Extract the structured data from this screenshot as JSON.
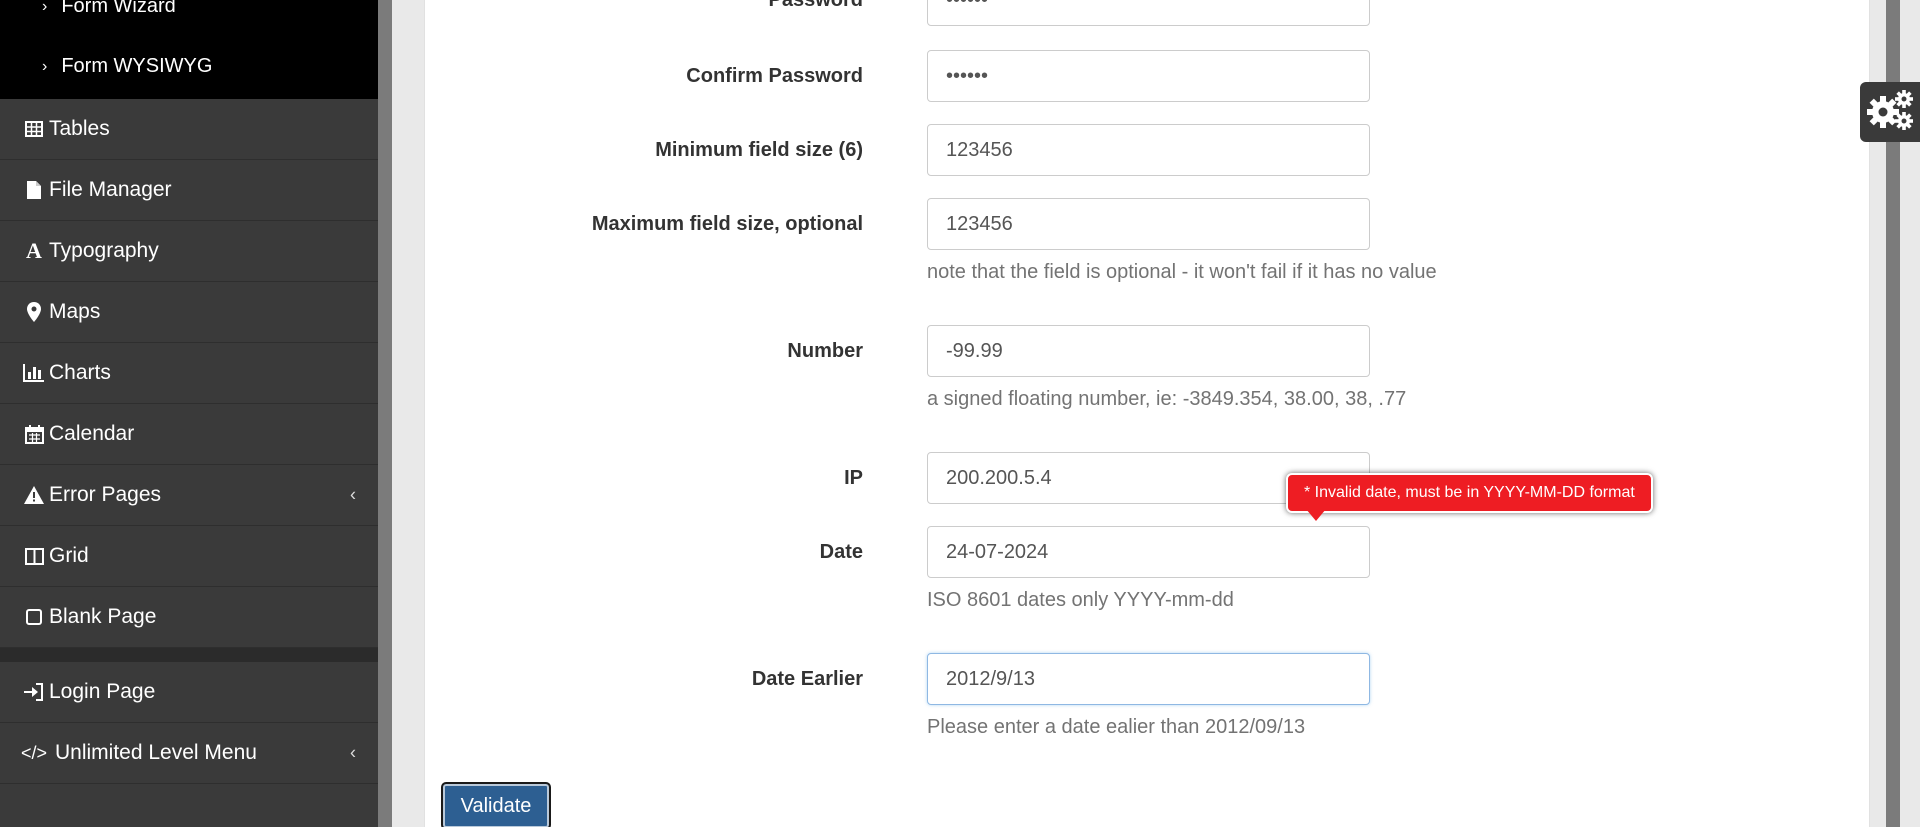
{
  "sidebar": {
    "submenu": [
      {
        "label": "Form Wizard"
      },
      {
        "label": "Form WYSIWYG"
      }
    ],
    "items": [
      {
        "label": "Tables",
        "icon": "table-icon"
      },
      {
        "label": "File Manager",
        "icon": "file-icon"
      },
      {
        "label": "Typography",
        "icon": "font-icon"
      },
      {
        "label": "Maps",
        "icon": "map-marker-icon"
      },
      {
        "label": "Charts",
        "icon": "bar-chart-icon"
      },
      {
        "label": "Calendar",
        "icon": "calendar-icon"
      },
      {
        "label": "Error Pages",
        "icon": "warning-icon"
      },
      {
        "label": "Grid",
        "icon": "columns-icon"
      },
      {
        "label": "Blank Page",
        "icon": "square-icon"
      },
      {
        "label": "Login Page",
        "icon": "sign-in-icon"
      },
      {
        "label": "Unlimited Level Menu",
        "icon": "code-icon"
      }
    ]
  },
  "form": {
    "password": {
      "label": "Password",
      "value": "••••••"
    },
    "confirm_password": {
      "label": "Confirm Password",
      "value": "••••••"
    },
    "min_size": {
      "label": "Minimum field size (6)",
      "value": "123456"
    },
    "max_size": {
      "label": "Maximum field size, optional",
      "value": "123456",
      "help": "note that the field is optional - it won't fail if it has no value"
    },
    "number": {
      "label": "Number",
      "value": "-99.99",
      "help": "a signed floating number, ie: -3849.354, 38.00, 38, .77"
    },
    "ip": {
      "label": "IP",
      "value": "200.200.5.4"
    },
    "date": {
      "label": "Date",
      "value": "24-07-2024",
      "help": "ISO 8601 dates only YYYY-mm-dd"
    },
    "date_earlier": {
      "label": "Date Earlier",
      "value": "2012/9/13",
      "help": "Please enter a date ealier than 2012/09/13"
    },
    "error_tooltip": "* Invalid date, must be in YYYY-MM-DD format",
    "validate_label": "Validate"
  },
  "colors": {
    "error": "#ee1d23",
    "button": "#2d5f92",
    "sidebar": "#3a3a3a"
  }
}
